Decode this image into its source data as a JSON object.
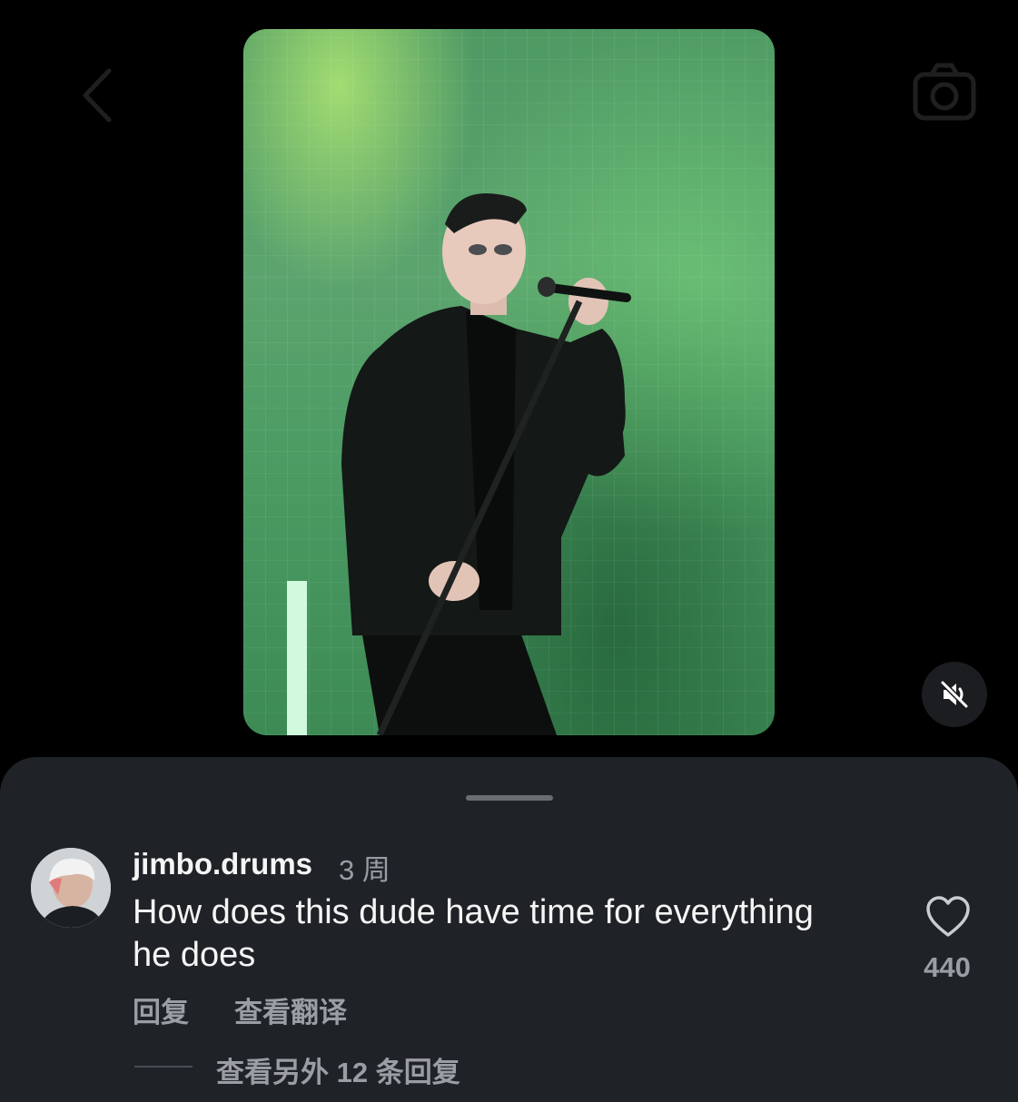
{
  "nav": {
    "back_icon": "chevron-left-icon",
    "camera_icon": "camera-icon"
  },
  "media": {
    "description_icon": "performer-photo",
    "mute_icon": "speaker-muted-icon"
  },
  "comment": {
    "username": "jimbo.drums",
    "time": "3 周",
    "text": "How does this dude have time for everything he does",
    "like_icon": "heart-icon",
    "like_count": "440",
    "reply_label": "回复",
    "translate_label": "查看翻译",
    "more_replies_label": "查看另外 12 条回复"
  },
  "colors": {
    "background": "#000000",
    "sheet": "#1f2226",
    "secondary_text": "#9a9da3",
    "accent_green": "#5ca46f"
  }
}
